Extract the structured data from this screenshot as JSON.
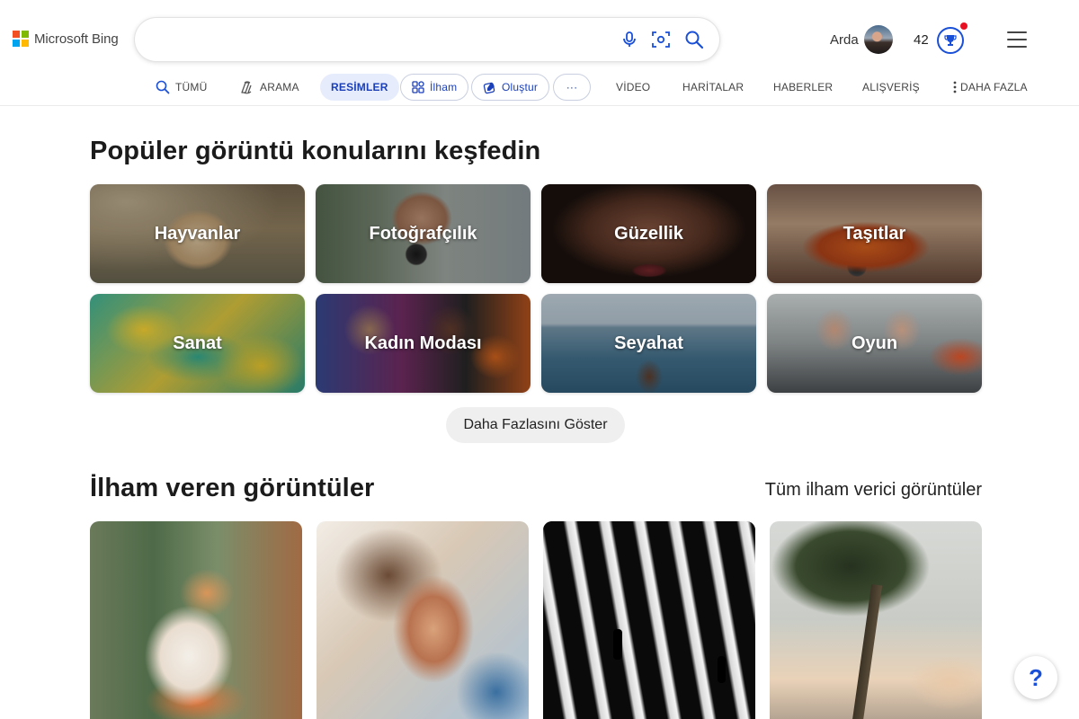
{
  "brand": {
    "name": "Microsoft Bing",
    "colors": [
      "#f25022",
      "#7fba00",
      "#00a4ef",
      "#ffb900"
    ]
  },
  "search": {
    "value": "",
    "placeholder": ""
  },
  "user": {
    "name": "Arda",
    "points": "42"
  },
  "tabs": [
    {
      "label": "TÜMÜ",
      "icon": "search-icon"
    },
    {
      "label": "ARAMA",
      "icon": "copilot-icon"
    },
    {
      "label": "RESİMLER",
      "active": true
    },
    {
      "label": "İlham",
      "icon": "inspire-icon"
    },
    {
      "label": "Oluştur",
      "icon": "create-icon"
    },
    {
      "label": "···"
    },
    {
      "label": "VİDEO"
    },
    {
      "label": "HARİTALAR"
    },
    {
      "label": "HABERLER"
    },
    {
      "label": "ALIŞVERİŞ"
    },
    {
      "label": "DAHA FAZLA",
      "icon": "more-vertical-icon"
    }
  ],
  "explore": {
    "title": "Popüler görüntü konularını keşfedin",
    "topics": [
      "Hayvanlar",
      "Fotoğrafçılık",
      "Güzellik",
      "Taşıtlar",
      "Sanat",
      "Kadın Modası",
      "Seyahat",
      "Oyun"
    ],
    "show_more": "Daha Fazlasını Göster"
  },
  "inspiring": {
    "title": "İlham veren görüntüler",
    "see_all": "Tüm ilham verici görüntüler"
  },
  "help": {
    "label": "?"
  },
  "accent": "#1a4fd8"
}
